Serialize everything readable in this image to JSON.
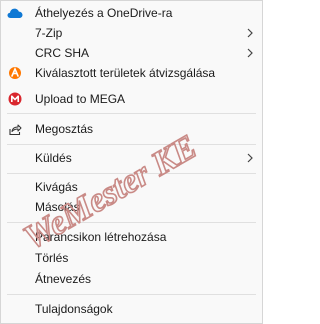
{
  "menu": {
    "items": [
      {
        "label": "Áthelyezés a OneDrive-ra",
        "icon": "onedrive-cloud-icon"
      },
      {
        "label": "7-Zip",
        "submenu": true
      },
      {
        "label": "CRC SHA",
        "submenu": true
      },
      {
        "label": "Kiválasztott területek átvizsgálása",
        "icon": "avast-icon"
      },
      {
        "label": "Upload to MEGA",
        "icon": "mega-icon"
      },
      {
        "label": "Megosztás",
        "icon": "share-icon"
      },
      {
        "label": "Küldés",
        "submenu": true
      },
      {
        "label": "Kivágás"
      },
      {
        "label": "Másolás"
      },
      {
        "label": "Parancsikon létrehozása"
      },
      {
        "label": "Törlés"
      },
      {
        "label": "Átnevezés"
      },
      {
        "label": "Tulajdonságok"
      }
    ]
  },
  "watermark": {
    "text": "WeMester KE",
    "color": "#c98a86"
  },
  "colors": {
    "onedrive": "#0f78d4",
    "avast": "#ff7800",
    "mega": "#d9272e",
    "text": "#1a1a1a"
  }
}
